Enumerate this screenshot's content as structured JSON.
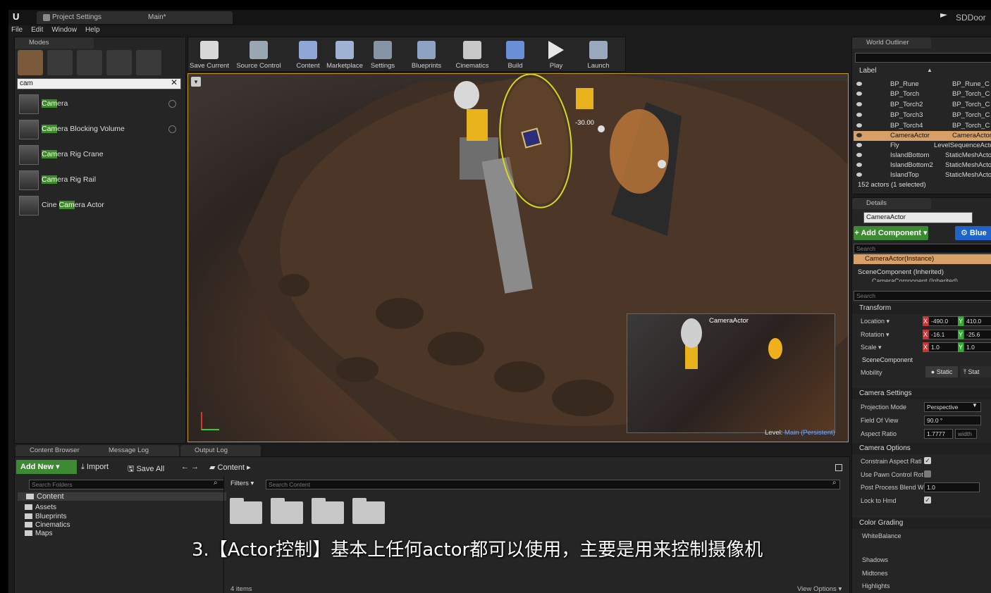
{
  "window": {
    "ue_logo": "U",
    "tabs": [
      "Project Settings",
      "Main*"
    ],
    "user": "SDDoor"
  },
  "menu": [
    "File",
    "Edit",
    "Window",
    "Help"
  ],
  "modes": {
    "tab": "Modes",
    "search_value": "cam",
    "items": [
      {
        "pre": "",
        "hl": "Cam",
        "post": "era"
      },
      {
        "pre": "",
        "hl": "Cam",
        "post": "era Blocking Volume"
      },
      {
        "pre": "",
        "hl": "Cam",
        "post": "era Rig Crane"
      },
      {
        "pre": "",
        "hl": "Cam",
        "post": "era Rig Rail"
      },
      {
        "pre": "Cine ",
        "hl": "Cam",
        "post": "era Actor"
      }
    ]
  },
  "toolbar": [
    "Save Current",
    "Source Control",
    "Content",
    "Marketplace",
    "Settings",
    "Blueprints",
    "Cinematics",
    "Build",
    "Play",
    "Launch"
  ],
  "viewport": {
    "rotation_label": "-30.00",
    "preview_title": "CameraActor",
    "level_prefix": "Level:",
    "level_name": "Main (Persistent)"
  },
  "outliner": {
    "tab": "World Outliner",
    "header": "Label",
    "rows": [
      {
        "name": "BP_Rune",
        "type": "BP_Rune_C"
      },
      {
        "name": "BP_Torch",
        "type": "BP_Torch_C"
      },
      {
        "name": "BP_Torch2",
        "type": "BP_Torch_C"
      },
      {
        "name": "BP_Torch3",
        "type": "BP_Torch_C"
      },
      {
        "name": "BP_Torch4",
        "type": "BP_Torch_C"
      },
      {
        "name": "CameraActor",
        "type": "CameraActor"
      },
      {
        "name": "Fly",
        "type": "LevelSequenceActor"
      },
      {
        "name": "IslandBottom",
        "type": "StaticMeshActor"
      },
      {
        "name": "IslandBottom2",
        "type": "StaticMeshActor"
      },
      {
        "name": "IslandTop",
        "type": "StaticMeshActor"
      }
    ],
    "status": "152 actors (1 selected)"
  },
  "details": {
    "tab": "Details",
    "name": "CameraActor",
    "add_component": "+ Add Component ▾",
    "blueprint": "Blue",
    "search_placeholder": "Search",
    "instance": "CameraActor(Instance)",
    "scene_component": "SceneComponent (Inherited)",
    "camera_component": "CameraComponent (Inherited)",
    "search2_placeholder": "Search",
    "transform": {
      "title": "Transform",
      "location_label": "Location ▾",
      "location_x": "-490.0",
      "location_y": "410.0",
      "rotation_label": "Rotation ▾",
      "rotation_x": "-16.1",
      "rotation_y": "-25.6",
      "scale_label": "Scale ▾",
      "scale_x": "1.0",
      "scale_y": "1.0",
      "scene_component": "SceneComponent",
      "mobility_label": "Mobility",
      "mobility_static": "Static",
      "mobility_stat2": "Stat"
    },
    "camera_settings": {
      "title": "Camera Settings",
      "projection_label": "Projection Mode",
      "projection_value": "Perspective",
      "fov_label": "Field Of View",
      "fov_value": "90.0 °",
      "aspect_label": "Aspect Ratio",
      "aspect_value": "1.7777",
      "aspect_unit": "width"
    },
    "camera_options": {
      "title": "Camera Options",
      "constrain_label": "Constrain Aspect Rati",
      "pawn_label": "Use Pawn Control Rot",
      "post_label": "Post Process Blend W",
      "post_value": "1.0",
      "lock_label": "Lock to Hmd"
    },
    "color_grading": {
      "title": "Color Grading",
      "items": [
        "WhiteBalance",
        "Shadows",
        "Midtones",
        "Highlights"
      ]
    }
  },
  "bottom_tabs": [
    "Content Browser",
    "Message Log",
    "Output Log"
  ],
  "content_browser": {
    "add_new": "Add New ▾",
    "import": "Import",
    "save_all": "Save All",
    "path": "Content",
    "search_folders": "Search Folders",
    "filters": "Filters ▾",
    "search_content": "Search Content",
    "tree": [
      "Content",
      "Assets",
      "Blueprints",
      "Cinematics",
      "Maps"
    ],
    "item_count": "4 items",
    "view_options": "View Options ▾"
  },
  "subtitle": "3.【Actor控制】基本上任何actor都可以使用，主要是用来控制摄像机"
}
